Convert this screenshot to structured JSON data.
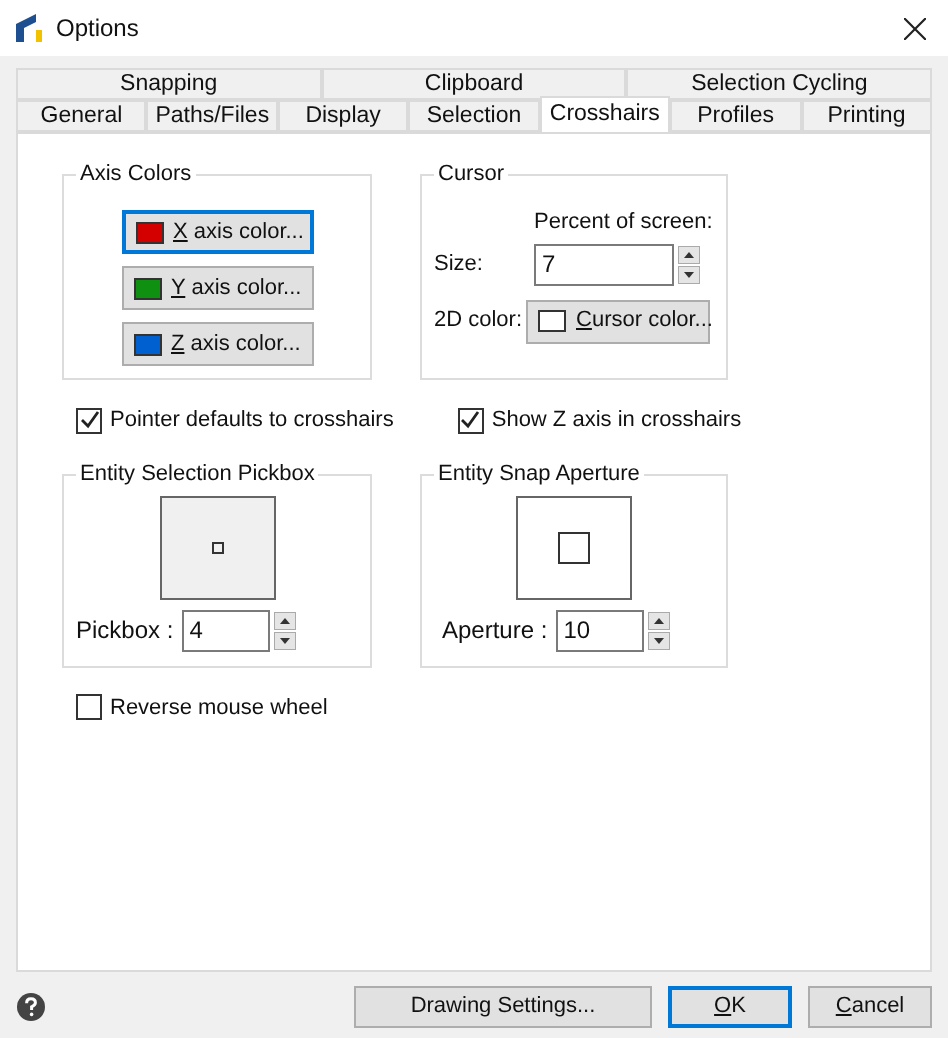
{
  "window": {
    "title": "Options"
  },
  "tab_rows": [
    [
      {
        "label": "Snapping",
        "selected": false
      },
      {
        "label": "Clipboard",
        "selected": false
      },
      {
        "label": "Selection Cycling",
        "selected": false
      }
    ],
    [
      {
        "label": "General",
        "selected": false
      },
      {
        "label": "Paths/Files",
        "selected": false
      },
      {
        "label": "Display",
        "selected": false
      },
      {
        "label": "Selection",
        "selected": false
      },
      {
        "label": "Crosshairs",
        "selected": true
      },
      {
        "label": "Profiles",
        "selected": false
      },
      {
        "label": "Printing",
        "selected": false
      }
    ]
  ],
  "axis_colors": {
    "title": "Axis Colors",
    "buttons": [
      {
        "accel": "X",
        "text": " axis color...",
        "color": "#d40000",
        "focused": true
      },
      {
        "accel": "Y",
        "text": " axis color...",
        "color": "#109010",
        "focused": false
      },
      {
        "accel": "Z",
        "text": " axis color...",
        "color": "#0060d0",
        "focused": false
      }
    ]
  },
  "cursor": {
    "title": "Cursor",
    "percent_label": "Percent of screen:",
    "size_label": "Size:",
    "size_value": "7",
    "color_label": "2D color:",
    "color_button": {
      "accel": "C",
      "text": "ursor color...",
      "color": "#ffffff"
    }
  },
  "checks_row": [
    {
      "label": "Pointer defaults to crosshairs",
      "checked": true
    },
    {
      "label": "Show Z axis in crosshairs",
      "checked": true
    }
  ],
  "pickbox": {
    "title": "Entity Selection Pickbox",
    "label": "Pickbox :",
    "value": "4"
  },
  "aperture": {
    "title": "Entity Snap Aperture",
    "label": "Aperture :",
    "value": "10"
  },
  "reverse_wheel": {
    "label": "Reverse mouse wheel",
    "checked": false
  },
  "footer": {
    "drawing_settings": "Drawing Settings...",
    "ok": {
      "accel": "O",
      "text": "K"
    },
    "cancel": {
      "accel": "C",
      "text": "ancel"
    }
  }
}
